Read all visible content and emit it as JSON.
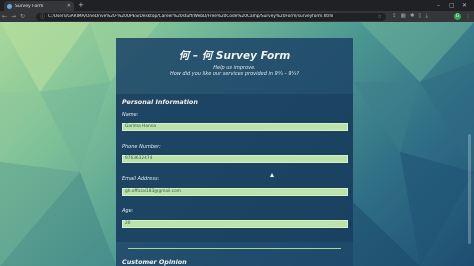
{
  "browser": {
    "tab_title": "Survey Form",
    "new_tab": "+",
    "url": "C:/Users/GARIMA/OneDrive%20-%20UPES/Desktop/Career%20stuff/WebD/Free%20Code%20Camp/Survey%20Form/surveyform.html",
    "window_controls": {
      "min": "–",
      "max": "▢",
      "close": "✕"
    },
    "profile_initial": "G"
  },
  "form": {
    "title": "何 – 何 Survey Form",
    "subtitle_line1": "Help us improve.",
    "subtitle_line2": "How did you like our services provided in 9¼ – 9¼?",
    "personal_section_title": "Personal Information",
    "fields": [
      {
        "label": "Name:",
        "value": "Garima Hanna"
      },
      {
        "label": "Phone Number:",
        "value": "9763632474"
      },
      {
        "label": "Email Address:",
        "value": "gh.official183@gmail.com"
      },
      {
        "label": "Age:",
        "value": "20"
      }
    ],
    "customer_section_title": "Customer Opinion"
  }
}
